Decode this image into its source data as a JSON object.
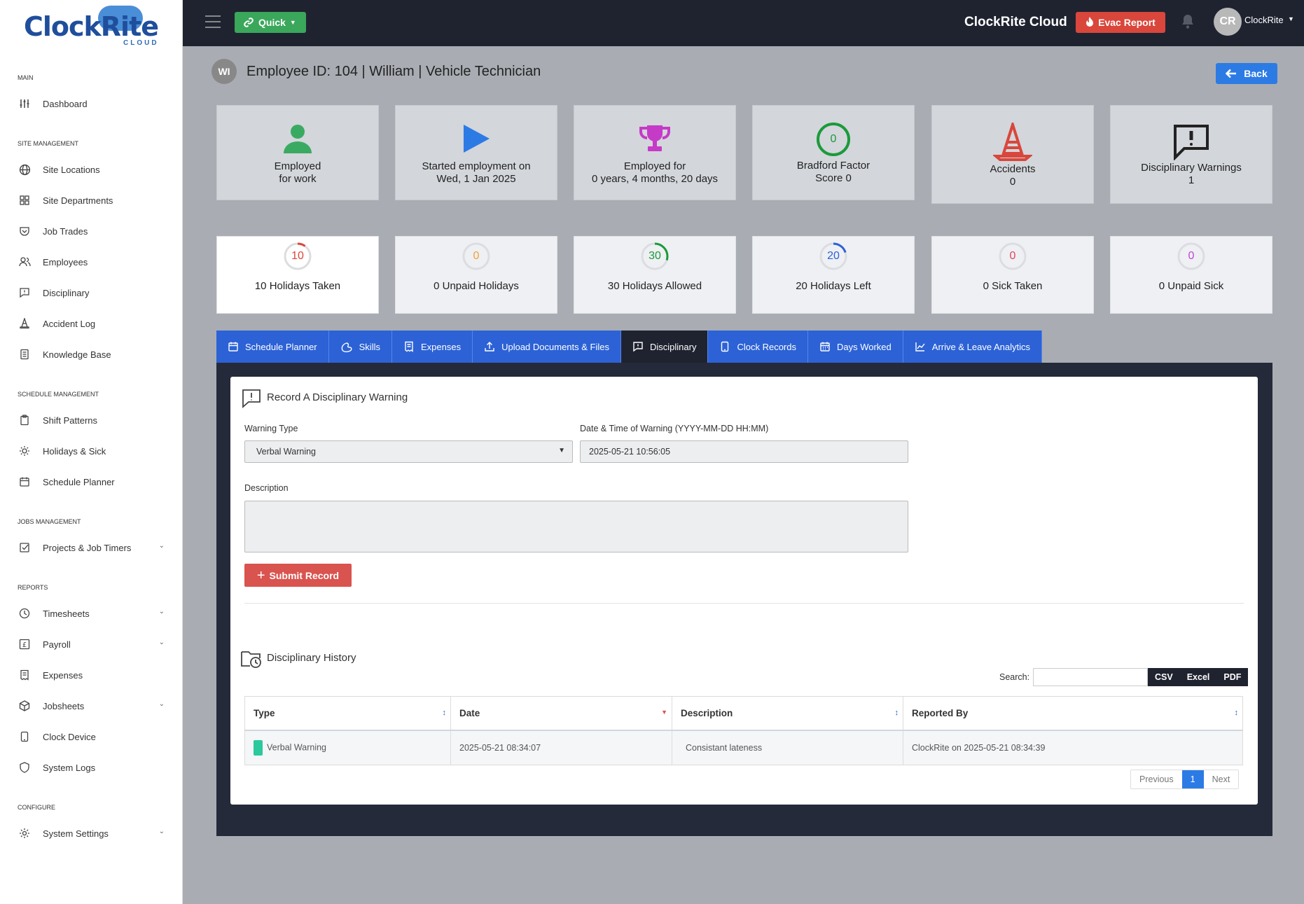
{
  "app": {
    "logo_text_a": "Clock",
    "logo_text_b": "Rite",
    "logo_sub": "CLOUD",
    "brand": "ClockRite Cloud",
    "quick_label": "Quick",
    "evac_label": "Evac Report",
    "user_initials": "CR",
    "user_name": "ClockRite"
  },
  "sidebar": {
    "sections": {
      "main": "MAIN",
      "site": "SITE MANAGEMENT",
      "schedule": "SCHEDULE MANAGEMENT",
      "jobs": "JOBS MANAGEMENT",
      "reports": "REPORTS",
      "configure": "CONFIGURE"
    },
    "items": {
      "dashboard": "Dashboard",
      "site_locations": "Site Locations",
      "site_departments": "Site Departments",
      "job_trades": "Job Trades",
      "employees": "Employees",
      "disciplinary": "Disciplinary",
      "accident_log": "Accident Log",
      "knowledge_base": "Knowledge Base",
      "shift_patterns": "Shift Patterns",
      "holidays_sick": "Holidays & Sick",
      "schedule_planner": "Schedule Planner",
      "projects": "Projects & Job Timers",
      "timesheets": "Timesheets",
      "payroll": "Payroll",
      "expenses": "Expenses",
      "jobsheets": "Jobsheets",
      "clock_device": "Clock Device",
      "system_logs": "System Logs",
      "system_settings": "System Settings"
    }
  },
  "header": {
    "emp_initials": "WI",
    "title": "Employee ID: 104 | William | Vehicle Technician",
    "back_label": "Back"
  },
  "stats": {
    "employed_l1": "Employed",
    "employed_l2": "for work",
    "started_l1": "Started employment on",
    "started_l2": "Wed, 1 Jan 2025",
    "tenure_l1": "Employed for",
    "tenure_l2": "0 years, 4 months, 20 days",
    "bradford_value": "0",
    "bradford_l1": "Bradford Factor",
    "bradford_l2": "Score 0",
    "accidents_l1": "Accidents",
    "accidents_l2": "0",
    "warnings_l1": "Disciplinary Warnings",
    "warnings_l2": "1"
  },
  "holidays": [
    {
      "value": "10",
      "label": "10 Holidays Taken",
      "color": "#d9463b",
      "fraction": 0.1
    },
    {
      "value": "0",
      "label": "0 Unpaid Holidays",
      "color": "#f0a13a",
      "fraction": 0
    },
    {
      "value": "30",
      "label": "30 Holidays Allowed",
      "color": "#1a9a3a",
      "fraction": 0.3
    },
    {
      "value": "20",
      "label": "20 Holidays Left",
      "color": "#2c62d6",
      "fraction": 0.2
    },
    {
      "value": "0",
      "label": "0 Sick Taken",
      "color": "#e0455a",
      "fraction": 0
    },
    {
      "value": "0",
      "label": "0 Unpaid Sick",
      "color": "#c044d6",
      "fraction": 0
    }
  ],
  "tabs": {
    "schedule_planner": "Schedule Planner",
    "skills": "Skills",
    "expenses": "Expenses",
    "upload": "Upload Documents & Files",
    "disciplinary": "Disciplinary",
    "clock_records": "Clock Records",
    "days_worked": "Days Worked",
    "analytics": "Arrive & Leave Analytics"
  },
  "form": {
    "title": "Record A Disciplinary Warning",
    "type_label": "Warning Type",
    "type_value": "Verbal Warning",
    "dt_label": "Date & Time of Warning (YYYY-MM-DD HH:MM)",
    "dt_value": "2025-05-21 10:56:05",
    "desc_label": "Description",
    "desc_value": "",
    "submit_label": "Submit Record"
  },
  "history": {
    "title": "Disciplinary History",
    "search_label": "Search:",
    "search_value": "",
    "export": {
      "csv": "CSV",
      "excel": "Excel",
      "pdf": "PDF"
    },
    "columns": {
      "type": "Type",
      "date": "Date",
      "description": "Description",
      "reported_by": "Reported By"
    },
    "rows": [
      {
        "type": "Verbal Warning",
        "date": "2025-05-21 08:34:07",
        "description": "Consistant lateness",
        "reported_by": "ClockRite on 2025-05-21 08:34:39"
      }
    ],
    "pager": {
      "prev": "Previous",
      "page": "1",
      "next": "Next"
    }
  }
}
